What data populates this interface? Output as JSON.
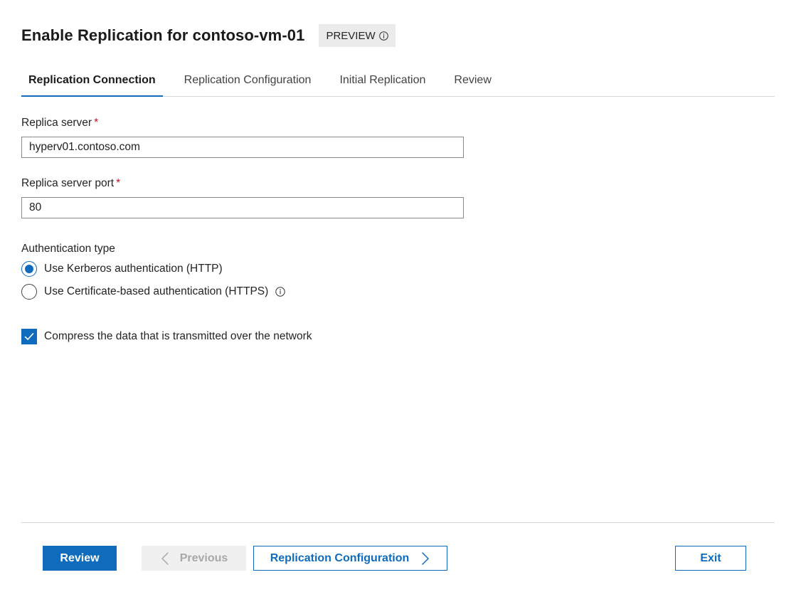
{
  "header": {
    "title": "Enable Replication for contoso-vm-01",
    "badge": "PREVIEW"
  },
  "tabs": [
    {
      "label": "Replication Connection",
      "active": true
    },
    {
      "label": "Replication Configuration",
      "active": false
    },
    {
      "label": "Initial Replication",
      "active": false
    },
    {
      "label": "Review",
      "active": false
    }
  ],
  "form": {
    "replica_server": {
      "label": "Replica server",
      "required_mark": "*",
      "value": "hyperv01.contoso.com"
    },
    "replica_port": {
      "label": "Replica server port",
      "required_mark": "*",
      "value": "80"
    },
    "auth": {
      "label": "Authentication type",
      "options": [
        {
          "label": "Use Kerberos authentication (HTTP)",
          "selected": true
        },
        {
          "label": "Use Certificate-based authentication (HTTPS)",
          "selected": false
        }
      ]
    },
    "compress": {
      "label": "Compress the data that is transmitted over the network",
      "checked": true
    }
  },
  "footer": {
    "review_label": "Review",
    "previous_label": "Previous",
    "next_label": "Replication Configuration",
    "exit_label": "Exit"
  },
  "colors": {
    "accent": "#0f6cbd",
    "required": "#c50f1f",
    "disabled_bg": "#f0f0f0",
    "badge_bg": "#ebebeb"
  },
  "icons": {
    "badge_info": "info-icon",
    "auth_info": "info-icon",
    "previous": "chevron-left-icon",
    "next": "chevron-right-icon",
    "checkmark": "checkmark-icon"
  }
}
